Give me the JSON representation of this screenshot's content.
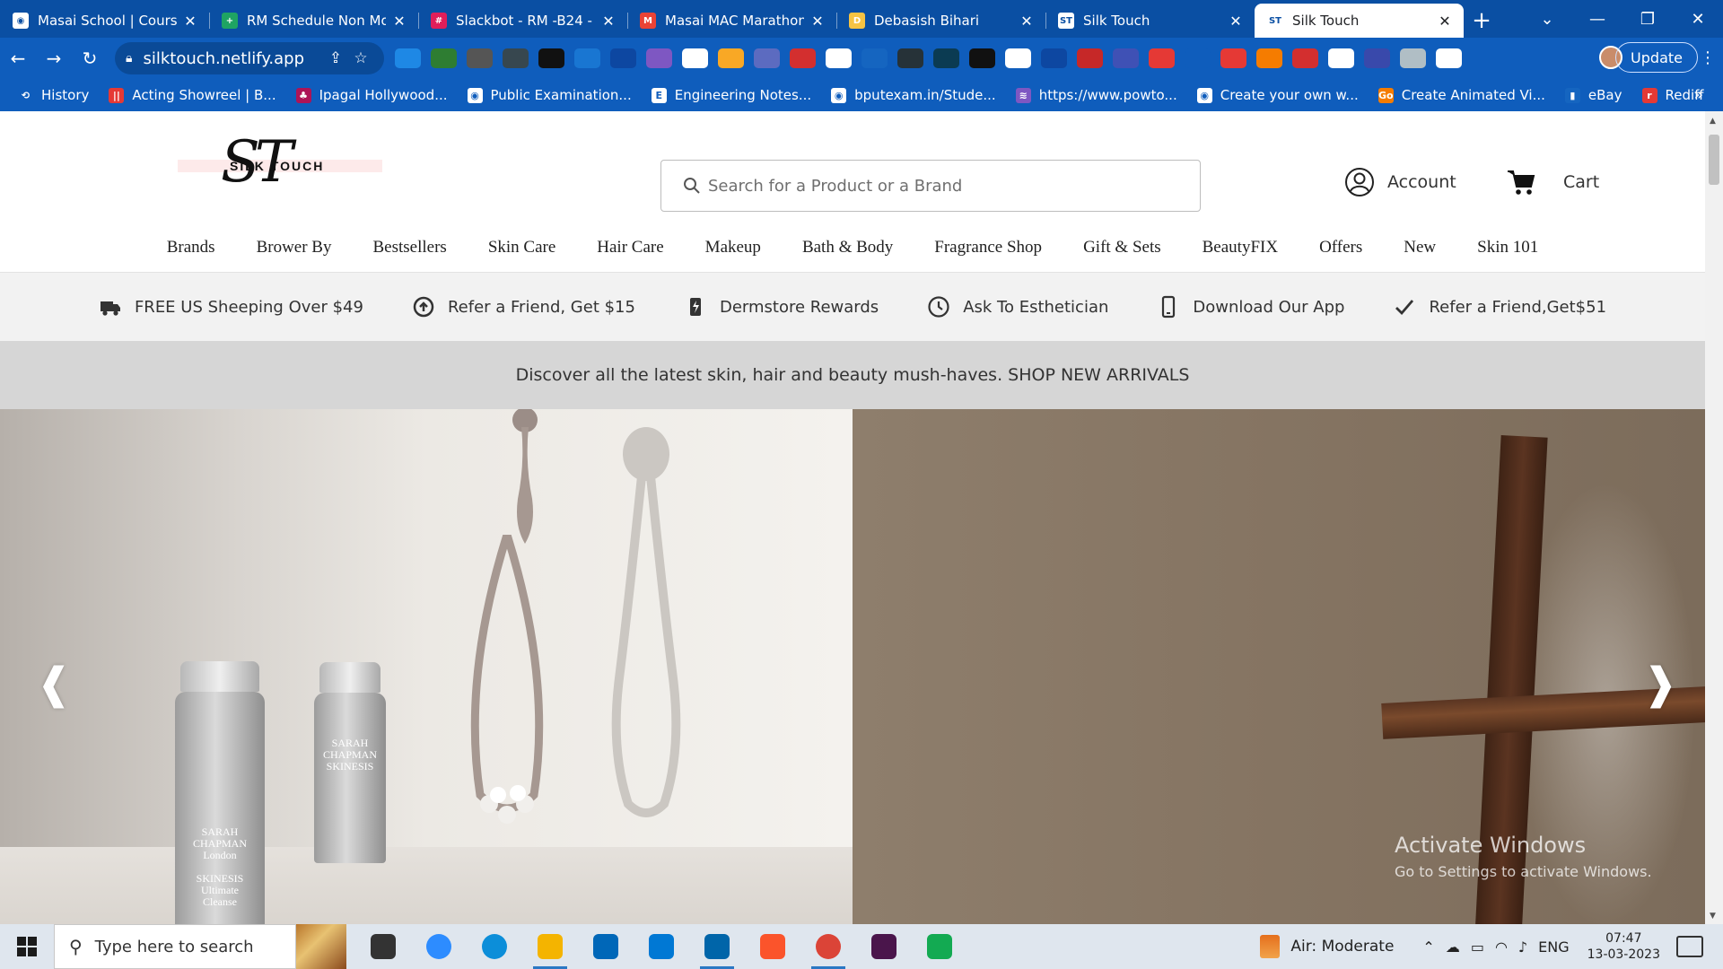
{
  "browser": {
    "tabs": [
      {
        "title": "Masai School | Course",
        "favicon_color": "#ffffff",
        "favicon_glyph": "◉"
      },
      {
        "title": "RM Schedule Non Mo",
        "favicon_color": "#1fa463",
        "favicon_glyph": "+"
      },
      {
        "title": "Slackbot - RM -B24 -",
        "favicon_color": "#e01e5a",
        "favicon_glyph": "#"
      },
      {
        "title": "Masai MAC Marathon",
        "favicon_color": "#ea4335",
        "favicon_glyph": "M"
      },
      {
        "title": "Debasish Bihari",
        "favicon_color": "#f6c343",
        "favicon_glyph": "D"
      },
      {
        "title": "Silk Touch",
        "favicon_color": "#ffffff",
        "favicon_glyph": "ST"
      },
      {
        "title": "Silk Touch",
        "favicon_color": "#ffffff",
        "favicon_glyph": "ST",
        "active": true
      }
    ],
    "new_tab_label": "+",
    "window_controls": {
      "list": "⌄",
      "minimize": "—",
      "restore": "❐",
      "close": "✕"
    },
    "nav": {
      "back": "←",
      "forward": "→",
      "reload": "↻"
    },
    "address": "silktouch.netlify.app",
    "update_label": "Update",
    "more_label": "⋮",
    "extension_colors": [
      "#1e88e5",
      "#2e7d32",
      "#555555",
      "#37474f",
      "#111111",
      "#1976d2",
      "#0d47a1",
      "#7e57c2",
      "#ffffff",
      "#f9a825",
      "#5c6bc0",
      "#d32f2f",
      "#ffffff",
      "#1565c0",
      "#263238",
      "#0b3b52",
      "#111111",
      "#ffffff",
      "#0d47a1",
      "#c62828",
      "#3f51b5",
      "#e53935",
      "#0f5dbc",
      "#e53935",
      "#f57c00",
      "#d32f2f",
      "#ffffff",
      "#3949ab",
      "#b0bec5",
      "#ffffff"
    ],
    "bookmarks": [
      {
        "label": "History",
        "color": "#0f5dbc",
        "glyph": "⟲"
      },
      {
        "label": "Acting Showreel | B...",
        "color": "#e53935",
        "glyph": "||"
      },
      {
        "label": "Ipagal Hollywood...",
        "color": "#ad1457",
        "glyph": "♣"
      },
      {
        "label": "Public Examination...",
        "color": "#ffffff",
        "glyph": "◉"
      },
      {
        "label": "Engineering Notes...",
        "color": "#ffffff",
        "glyph": "E"
      },
      {
        "label": "bputexam.in/Stude...",
        "color": "#ffffff",
        "glyph": "◉"
      },
      {
        "label": "https://www.powto...",
        "color": "#7e57c2",
        "glyph": "≋"
      },
      {
        "label": "Create your own w...",
        "color": "#ffffff",
        "glyph": "◉"
      },
      {
        "label": "Create Animated Vi...",
        "color": "#f57c00",
        "glyph": "Go"
      },
      {
        "label": "eBay",
        "color": "#1565c0",
        "glyph": "▮"
      },
      {
        "label": "Rediff",
        "color": "#e53935",
        "glyph": "r"
      }
    ],
    "bookmarks_more": "»"
  },
  "site": {
    "logo": {
      "monogram": "ST",
      "wordmark": "SILK TOUCH"
    },
    "search_placeholder": "Search for a Product or a Brand",
    "account_label": "Account",
    "cart_label": "Cart",
    "nav": [
      "Brands",
      "Brower By",
      "Bestsellers",
      "Skin Care",
      "Hair Care",
      "Makeup",
      "Bath & Body",
      "Fragrance Shop",
      "Gift & Sets",
      "BeautyFIX",
      "Offers",
      "New",
      "Skin 101"
    ],
    "perks": [
      {
        "label": "FREE US Sheeping Over $49",
        "icon": "truck-icon"
      },
      {
        "label": "Refer a Friend, Get $15",
        "icon": "refer-icon"
      },
      {
        "label": "Dermstore Rewards",
        "icon": "rewards-icon"
      },
      {
        "label": "Ask To Esthetician",
        "icon": "clock-icon"
      },
      {
        "label": "Download Our App",
        "icon": "phone-icon"
      },
      {
        "label": "Refer a Friend,Get$51",
        "icon": "check-icon"
      }
    ],
    "promo_text": "Discover all the latest skin, hair and beauty mush-haves. SHOP NEW ARRIVALS",
    "hero": {
      "prev": "❰",
      "next": "❱",
      "product_labels": {
        "bottle_1": "SARAH\nCHAPMAN\nLondon\n\nSKINESIS\nUltimate\nCleanse",
        "bottle_2": "SARAH\nCHAPMAN\nSKINESIS"
      }
    }
  },
  "overlay": {
    "activate_title": "Activate Windows",
    "activate_sub": "Go to Settings to activate Windows."
  },
  "taskbar": {
    "search_placeholder": "Type here to search",
    "apps": [
      {
        "name": "task-view",
        "color": "#333333"
      },
      {
        "name": "zoom",
        "color": "#2d8cff"
      },
      {
        "name": "edge",
        "color": "#0c8ed9"
      },
      {
        "name": "file-explorer",
        "color": "#f4b400"
      },
      {
        "name": "store",
        "color": "#0067b8"
      },
      {
        "name": "mail",
        "color": "#0078d4"
      },
      {
        "name": "vscode",
        "color": "#0065a9"
      },
      {
        "name": "brave",
        "color": "#fb542b"
      },
      {
        "name": "chrome",
        "color": "#db4437"
      },
      {
        "name": "slack",
        "color": "#4a154b"
      },
      {
        "name": "mongodb",
        "color": "#13aa52"
      }
    ],
    "air_quality": "Air: Moderate",
    "language": "ENG",
    "time": "07:47",
    "date": "13-03-2023"
  }
}
